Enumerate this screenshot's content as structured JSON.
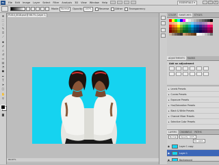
{
  "menubar": {
    "logo": "Ps",
    "items": [
      "File",
      "Edit",
      "Image",
      "Layer",
      "Select",
      "Filter",
      "Analysis",
      "3D",
      "View",
      "Window",
      "Help"
    ],
    "workspace": "ESSENTIALS ▾",
    "window_controls": [
      "–",
      "□",
      "×"
    ]
  },
  "options": {
    "mode_label": "Mode:",
    "mode_value": "Normal",
    "opacity_label": "Opacity:",
    "opacity_value": "100%",
    "reverse_label": "Reverse",
    "dither_label": "Dither",
    "transparency_label": "Transparency"
  },
  "document": {
    "tab_title": "P1010_0018.psd @ 66.7% (Layer 1, RGB/8) ×",
    "canvas_color": "#15d3f0",
    "status": "66.67%"
  },
  "panels": {
    "color_tabs": [
      "COLOR",
      "SWATCHES",
      "STYLES"
    ],
    "adjustments_tabs": [
      "ADJUSTMENTS",
      "MASKS"
    ],
    "adjustments_title": "Add an adjustment",
    "presets": [
      "Levels Presets",
      "Curves Presets",
      "Exposure Presets",
      "Hue/Saturation Presets",
      "Black & White Presets",
      "Channel Mixer Presets",
      "Selective Color Presets"
    ],
    "layers_tabs": [
      "LAYERS",
      "CHANNELS",
      "PATHS"
    ],
    "blend_mode": "Normal",
    "opacity": "Opacity: 100%",
    "fill": "Fill: 100%",
    "layers": [
      {
        "name": "Layer 1 copy",
        "selected": false
      },
      {
        "name": "Layer 1",
        "selected": true
      },
      {
        "name": "Background",
        "selected": false
      }
    ]
  },
  "swatch_colors": [
    "#ff0000",
    "#ffff00",
    "#00ff00",
    "#00ffff",
    "#0000ff",
    "#ff00ff",
    "#ffffff",
    "#e6e6e6",
    "#cccccc",
    "#b3b3b3",
    "#999999",
    "#808080",
    "#666666",
    "#4d4d4d",
    "#333333",
    "#000000",
    "#f7977a",
    "#f9ad81",
    "#fdc68a",
    "#fff79a",
    "#c4df9b",
    "#a2d39c",
    "#82ca9d",
    "#7bcdc8",
    "#6ecff6",
    "#7ea7d8",
    "#8493ca",
    "#8882be",
    "#a187be",
    "#bc8dbf",
    "#f49ac2",
    "#f6989d",
    "#ed1c24",
    "#f26522",
    "#f7941d",
    "#fff200",
    "#8dc63f",
    "#39b54a",
    "#00a651",
    "#00a99d",
    "#00aeef",
    "#0072bc",
    "#0054a6",
    "#2e3192",
    "#662d91",
    "#92278f",
    "#ec008c",
    "#ed145b",
    "#9e0b0f",
    "#a0410d",
    "#a36209",
    "#aba000",
    "#598527",
    "#1a7b30",
    "#007236",
    "#00746b",
    "#0076a3",
    "#004b80",
    "#003471",
    "#1b1464",
    "#440e62",
    "#630460",
    "#9e005d",
    "#9e0039",
    "#790000",
    "#7b2e00",
    "#7d4900",
    "#827b00",
    "#406618",
    "#005e20",
    "#005826",
    "#005952",
    "#005b7f",
    "#003663",
    "#002157",
    "#0d004c",
    "#32004b",
    "#4b0049",
    "#7b0046",
    "#7a0026",
    "#c7b299",
    "#998675",
    "#736357",
    "#534741",
    "#37302d",
    "#c69c6d",
    "#a67c52",
    "#8c6239",
    "#754c24",
    "#603913",
    "#ffffff",
    "#f2f2f2",
    "#e0e0e0",
    "#c0c0c0",
    "#a0a0a0",
    "#707070"
  ]
}
